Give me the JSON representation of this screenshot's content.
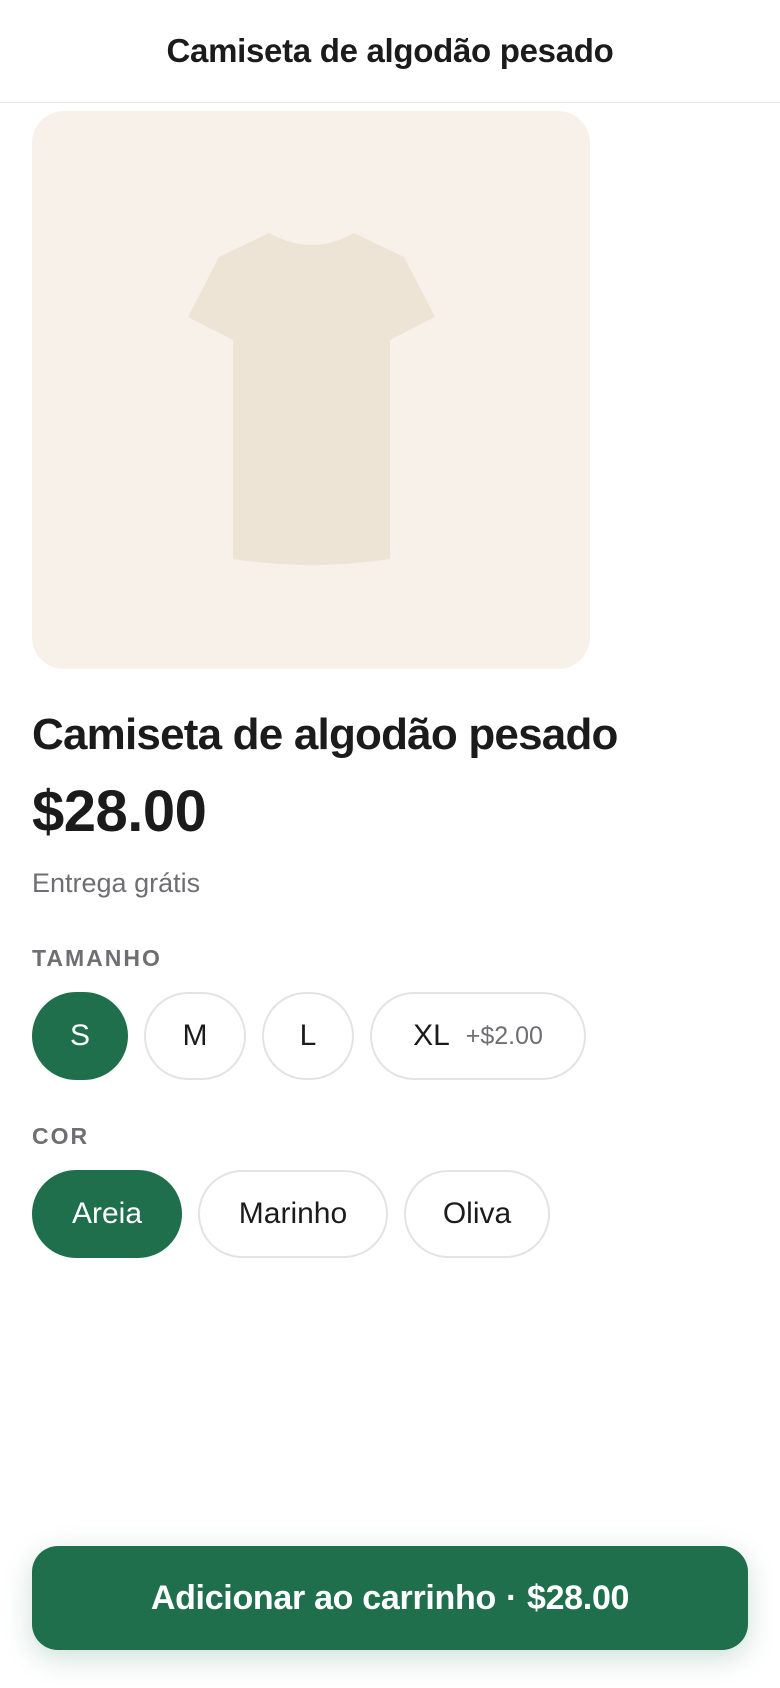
{
  "header": {
    "title": "Camiseta de algodão pesado"
  },
  "product": {
    "image_icon": "t-shirt-illustration",
    "title": "Camiseta de algodão pesado",
    "price": "$28.00",
    "delivery": "Entrega grátis"
  },
  "size": {
    "label": "TAMANHO",
    "options": [
      {
        "label": "S",
        "selected": true
      },
      {
        "label": "M",
        "selected": false
      },
      {
        "label": "L",
        "selected": false
      },
      {
        "label": "XL",
        "extra": "+$2.00",
        "selected": false
      }
    ]
  },
  "color": {
    "label": "COR",
    "options": [
      {
        "label": "Areia",
        "selected": true
      },
      {
        "label": "Marinho",
        "selected": false
      },
      {
        "label": "Oliva",
        "selected": false
      }
    ]
  },
  "cta": {
    "label": "Adicionar ao carrinho",
    "separator": "·",
    "price": "$28.00"
  },
  "colors": {
    "accent": "#1f6f4c",
    "image_background": "#f7f1ea",
    "shirt": "#ede4d6",
    "muted_text": "#6e6e73"
  }
}
